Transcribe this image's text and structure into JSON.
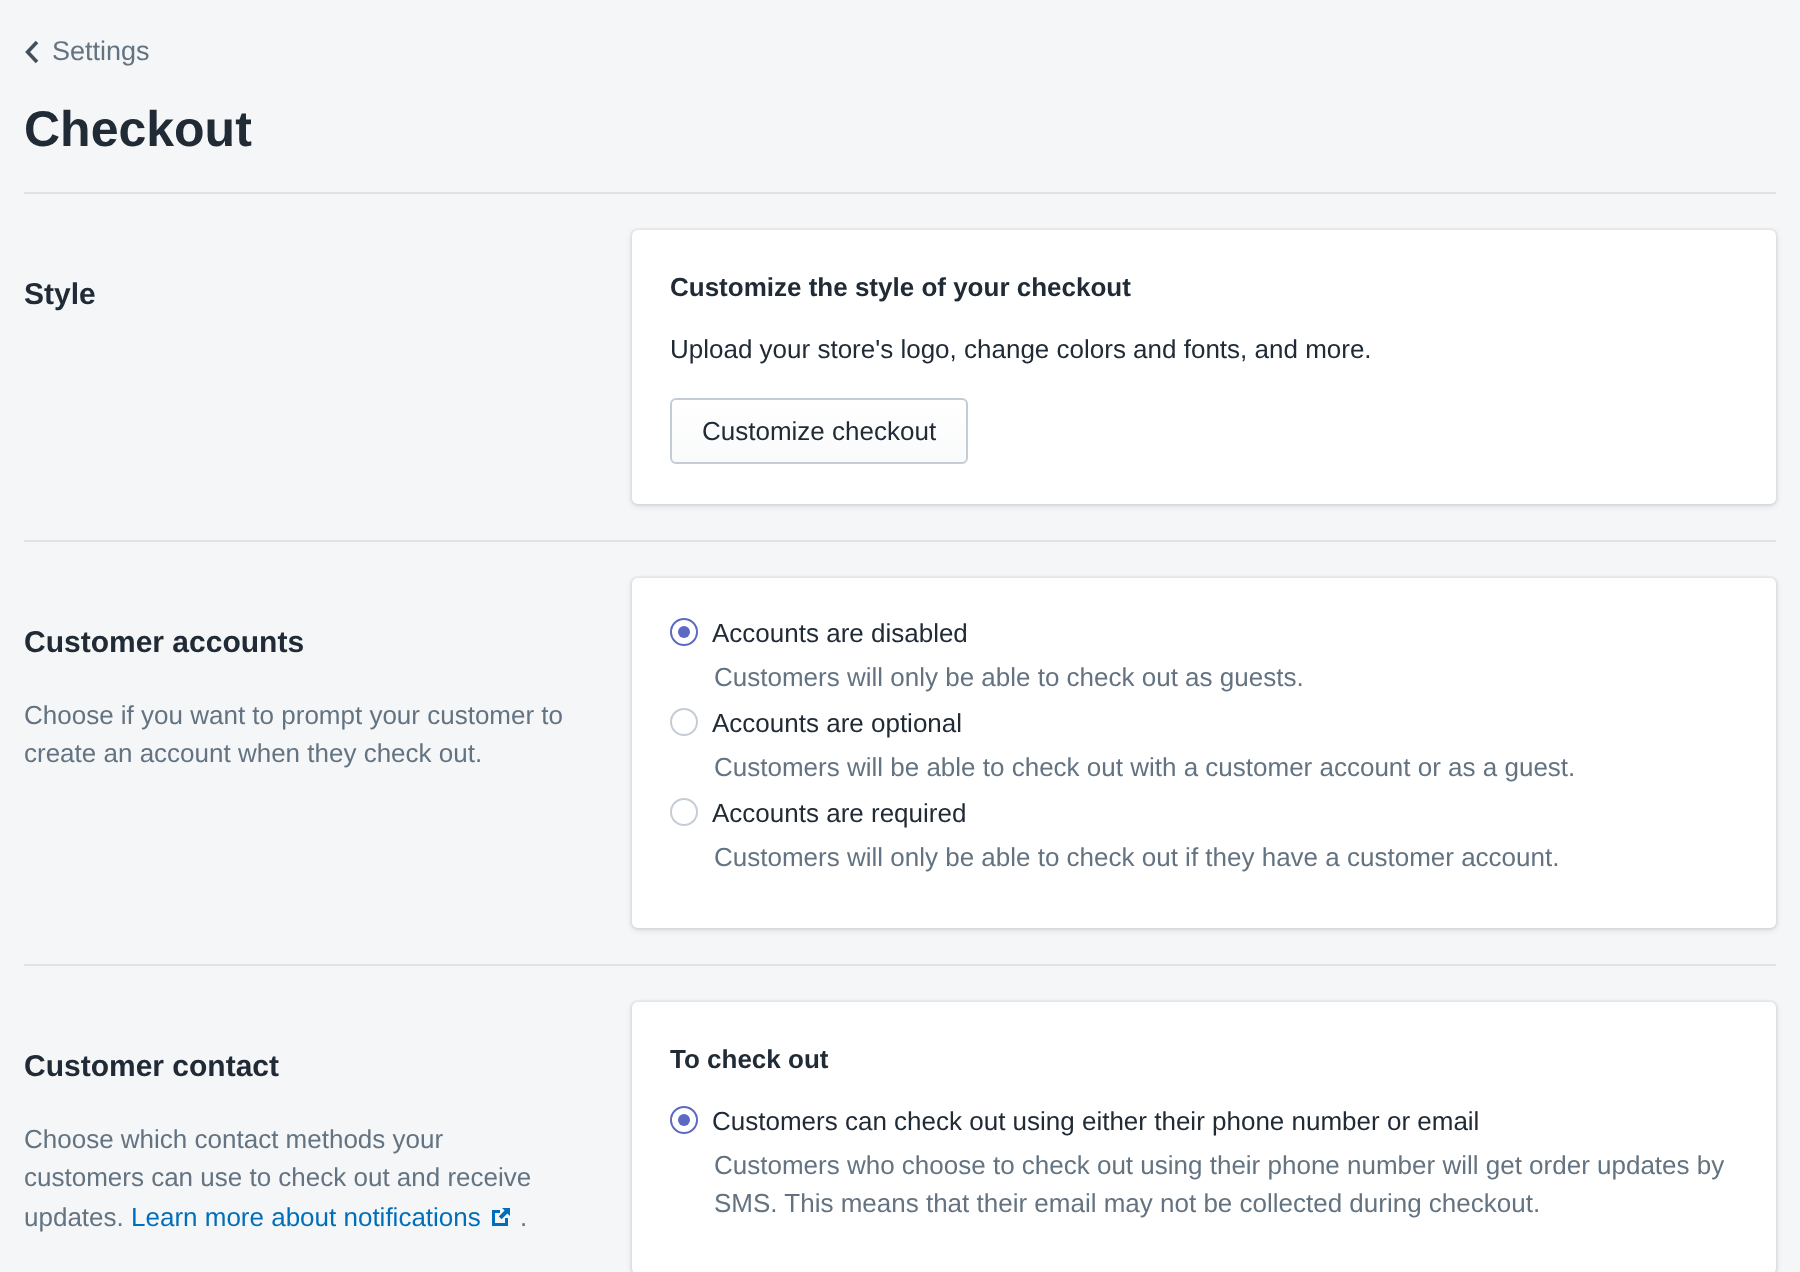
{
  "breadcrumb": {
    "label": "Settings"
  },
  "title": "Checkout",
  "sections": [
    {
      "title": "Style",
      "card": {
        "heading": "Customize the style of your checkout",
        "text": "Upload your store's logo, change colors and fonts, and more.",
        "button": "Customize checkout"
      }
    },
    {
      "title": "Customer accounts",
      "description": "Choose if you want to prompt your customer to create an account when they check out.",
      "card": {
        "options": [
          {
            "label": "Accounts are disabled",
            "help": "Customers will only be able to check out as guests.",
            "selected": true
          },
          {
            "label": "Accounts are optional",
            "help": "Customers will be able to check out with a customer account or as a guest.",
            "selected": false
          },
          {
            "label": "Accounts are required",
            "help": "Customers will only be able to check out if they have a customer account.",
            "selected": false
          }
        ]
      }
    },
    {
      "title": "Customer contact",
      "description": "Choose which contact methods your customers can use to check out and receive updates.",
      "link": "Learn more about notifications",
      "after_link": ".",
      "card": {
        "heading": "To check out",
        "options": [
          {
            "label": "Customers can check out using either their phone number or email",
            "help": "Customers who choose to check out using their phone number will get order updates by SMS. This means that their email may not be collected during checkout.",
            "selected": true
          }
        ]
      }
    }
  ]
}
